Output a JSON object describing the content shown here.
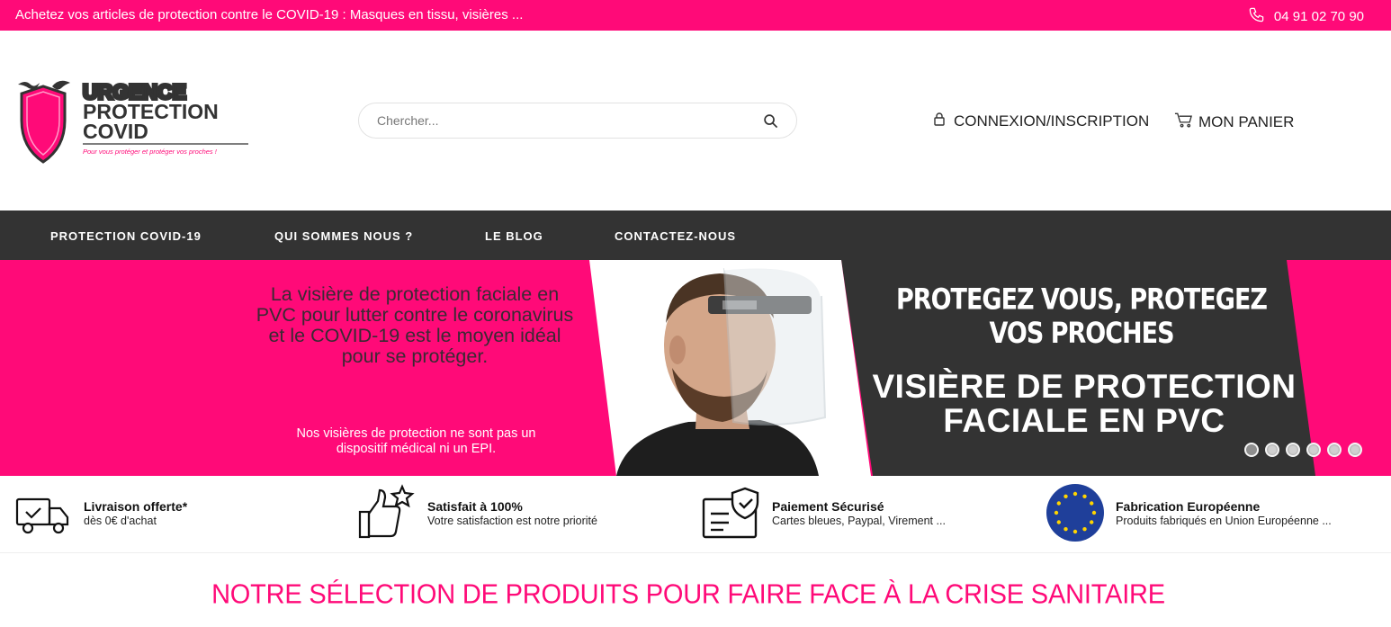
{
  "topbar": {
    "promo": "Achetez vos articles de protection contre le COVID-19 : Masques en tissu, visières ...",
    "phone": "04 91 02 70 90"
  },
  "logo": {
    "line1": "URGENCE",
    "line2": "PROTECTION",
    "line3": "COVID",
    "tagline": "Pour vous protéger et protéger vos proches !"
  },
  "search": {
    "placeholder": "Chercher..."
  },
  "header": {
    "account": "CONNEXION/INSCRIPTION",
    "cart": "MON PANIER"
  },
  "nav": {
    "items": [
      {
        "label": "PROTECTION COVID-19"
      },
      {
        "label": "QUI SOMMES NOUS ?"
      },
      {
        "label": "LE BLOG"
      },
      {
        "label": "CONTACTEZ-NOUS"
      }
    ]
  },
  "hero": {
    "text": "La visière de protection faciale en PVC pour lutter contre le coronavirus et le COVID-19 est le moyen idéal pour se protéger.",
    "note": "Nos visières de protection ne sont pas un dispositif médical ni un EPI.",
    "tagline": "PROTEGEZ VOUS, PROTEGEZ VOS PROCHES",
    "title": "VISIÈRE DE PROTECTION FACIALE EN PVC",
    "slides_total": 6,
    "active_slide": 1
  },
  "features": [
    {
      "title": "Livraison offerte*",
      "subtitle": "dès 0€ d'achat",
      "icon": "delivery-truck-icon"
    },
    {
      "title": "Satisfait à 100%",
      "subtitle": "Votre satisfaction est notre priorité",
      "icon": "thumbs-up-star-icon"
    },
    {
      "title": "Paiement Sécurisé",
      "subtitle": "Cartes bleues, Paypal, Virement ...",
      "icon": "secure-payment-icon"
    },
    {
      "title": "Fabrication Européenne",
      "subtitle": "Produits fabriqués en Union Européenne ...",
      "icon": "eu-flag-icon"
    }
  ],
  "section": {
    "title": "NOTRE SÉLECTION DE PRODUITS POUR FAIRE FACE À LA CRISE SANITAIRE"
  },
  "colors": {
    "brand_pink": "#ff0a78",
    "nav_dark": "#333333",
    "hero_dark": "#333333"
  }
}
